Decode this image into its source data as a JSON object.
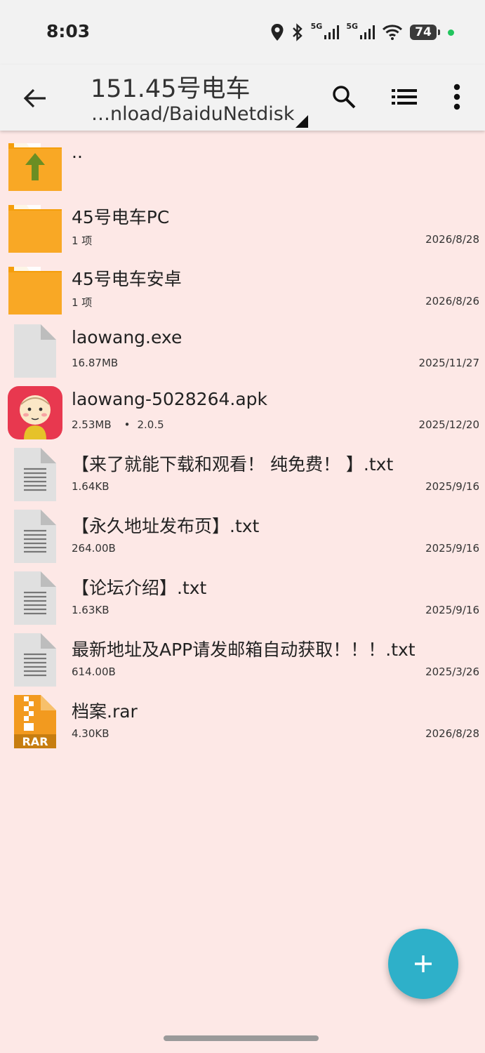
{
  "status_bar": {
    "time": "8:03",
    "network_1": "5G",
    "network_2": "5G",
    "battery": "74"
  },
  "app_bar": {
    "title": "151.45号电车",
    "path": "…nload/BaiduNetdisk",
    "icons": [
      "back-arrow-icon",
      "search-icon",
      "list-view-icon",
      "more-vert-icon"
    ]
  },
  "files": [
    {
      "name": "..",
      "type": "parent-folder",
      "meta": "",
      "date": ""
    },
    {
      "name": "45号电车PC",
      "type": "folder",
      "meta": "1 项",
      "date": "2026/8/28"
    },
    {
      "name": "45号电车安卓",
      "type": "folder",
      "meta": "1 项",
      "date": "2026/8/26"
    },
    {
      "name": "laowang.exe",
      "type": "file",
      "meta": "16.87MB",
      "date": "2025/11/27"
    },
    {
      "name": "laowang-5028264.apk",
      "type": "apk",
      "meta": "2.53MB",
      "version": "2.0.5",
      "date": "2025/12/20"
    },
    {
      "name": "【来了就能下载和观看！ 纯免费！ 】.txt",
      "type": "text",
      "meta": "1.64KB",
      "date": "2025/9/16"
    },
    {
      "name": "【永久地址发布页】.txt",
      "type": "text",
      "meta": "264.00B",
      "date": "2025/9/16"
    },
    {
      "name": "【论坛介绍】.txt",
      "type": "text",
      "meta": "1.63KB",
      "date": "2025/9/16"
    },
    {
      "name": "最新地址及APP请发邮箱自动获取！！！.txt",
      "type": "text",
      "meta": "614.00B",
      "date": "2025/3/26"
    },
    {
      "name": "档案.rar",
      "type": "archive",
      "meta": "4.30KB",
      "date": "2026/8/28",
      "badge": "RAR"
    }
  ],
  "colors": {
    "background": "#fde8e6",
    "bar": "#f2f2f2",
    "folder": "#f9a825",
    "fab": "#2eb0c9",
    "apk_icon": "#e8384f"
  }
}
